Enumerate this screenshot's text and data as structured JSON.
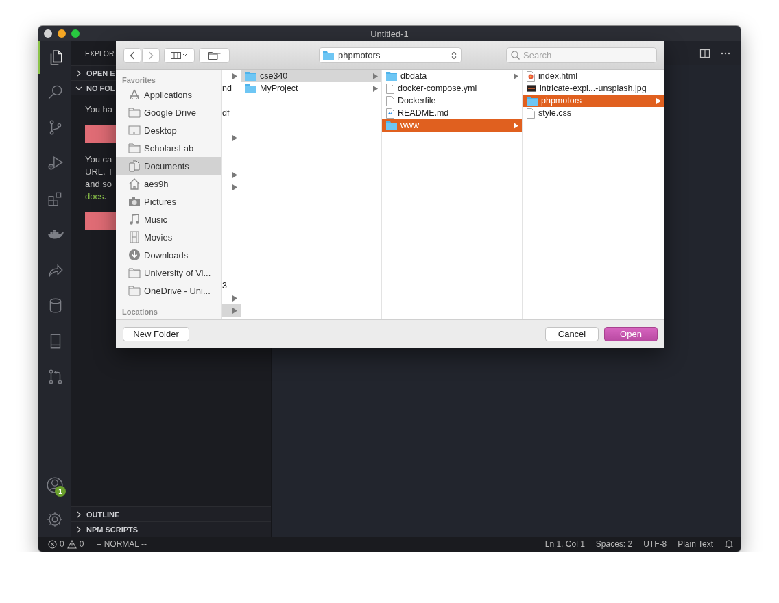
{
  "window": {
    "title": "Untitled-1"
  },
  "activity_bar": {
    "items": [
      {
        "selected": true
      },
      {
        "selected": false
      },
      {
        "selected": false
      },
      {
        "selected": false
      },
      {
        "selected": false
      },
      {
        "selected": false
      },
      {
        "selected": false
      },
      {
        "selected": false
      },
      {
        "selected": false
      },
      {
        "selected": false
      }
    ],
    "account_badge": "1"
  },
  "sidebar": {
    "title": "EXPLOR",
    "sections": [
      {
        "label": "OPEN E",
        "expanded": false
      },
      {
        "label": "NO FOL",
        "expanded": true
      }
    ],
    "content": [
      {
        "kind": "text",
        "text": "You ha"
      },
      {
        "kind": "button"
      },
      {
        "kind": "paragraph",
        "lines": [
          "You ca",
          "URL. T",
          "and so"
        ],
        "link": "docs",
        "after_link": "."
      },
      {
        "kind": "button"
      }
    ],
    "bottom_sections": [
      {
        "label": "OUTLINE",
        "expanded": false
      },
      {
        "label": "NPM SCRIPTS",
        "expanded": false
      }
    ]
  },
  "dialog": {
    "location": "phpmotors",
    "search": {
      "placeholder": "Search"
    },
    "sidebar": {
      "sections": [
        {
          "title": "Favorites",
          "items": [
            {
              "label": "Applications",
              "selected": false
            },
            {
              "label": "Google Drive",
              "selected": false
            },
            {
              "label": "Desktop",
              "selected": false
            },
            {
              "label": "ScholarsLab",
              "selected": false
            },
            {
              "label": "Documents",
              "selected": true
            },
            {
              "label": "aes9h",
              "selected": false
            },
            {
              "label": "Pictures",
              "selected": false
            },
            {
              "label": "Music",
              "selected": false
            },
            {
              "label": "Movies",
              "selected": false
            },
            {
              "label": "Downloads",
              "selected": false
            },
            {
              "label": "University of Vi...",
              "selected": false
            },
            {
              "label": "OneDrive - Uni...",
              "selected": false
            }
          ]
        },
        {
          "title": "Locations"
        }
      ]
    },
    "columns": [
      {
        "focused": false,
        "items": [
          {
            "kind": "cut",
            "has_children": true,
            "selected": false
          },
          {
            "kind": "cut",
            "label": "nd",
            "has_children": false,
            "selected": false
          },
          {
            "kind": "cut",
            "has_children": false,
            "selected": false
          },
          {
            "kind": "cut",
            "label": "df",
            "has_children": false,
            "selected": false
          },
          {
            "kind": "cut",
            "has_children": false,
            "selected": false
          },
          {
            "kind": "cut",
            "has_children": true,
            "selected": false
          },
          {
            "kind": "cut",
            "has_children": false,
            "selected": false
          },
          {
            "kind": "cut",
            "has_children": false,
            "selected": false
          },
          {
            "kind": "cut",
            "has_children": true,
            "selected": false
          },
          {
            "kind": "cut",
            "has_children": true,
            "selected": false
          },
          {
            "kind": "cut",
            "has_children": false,
            "selected": false
          },
          {
            "kind": "cut",
            "has_children": false,
            "selected": false
          },
          {
            "kind": "cut",
            "has_children": false,
            "selected": false
          },
          {
            "kind": "cut",
            "has_children": false,
            "selected": false
          },
          {
            "kind": "cut",
            "has_children": false,
            "selected": false
          },
          {
            "kind": "cut",
            "has_children": false,
            "selected": false
          },
          {
            "kind": "cut",
            "has_children": false,
            "selected": false
          },
          {
            "kind": "cut",
            "label": "3",
            "has_children": false,
            "selected": false
          },
          {
            "kind": "cut",
            "has_children": true,
            "selected": false
          },
          {
            "kind": "cut",
            "has_children": true,
            "selected": true
          }
        ]
      },
      {
        "focused": false,
        "items": [
          {
            "kind": "folder",
            "label": "cse340",
            "has_children": true,
            "selected": true
          },
          {
            "kind": "folder",
            "label": "MyProject",
            "has_children": true,
            "selected": false
          }
        ]
      },
      {
        "focused": true,
        "items": [
          {
            "kind": "folder",
            "label": "dbdata",
            "has_children": true,
            "selected": false
          },
          {
            "kind": "file",
            "label": "docker-compose.yml",
            "has_children": false,
            "selected": false
          },
          {
            "kind": "file",
            "label": "Dockerfile",
            "has_children": false,
            "selected": false
          },
          {
            "kind": "code",
            "label": "README.md",
            "has_children": false,
            "selected": false
          },
          {
            "kind": "folder",
            "label": "www",
            "has_children": true,
            "selected": true
          }
        ]
      },
      {
        "focused": true,
        "items": [
          {
            "kind": "html",
            "label": "index.html",
            "has_children": false,
            "selected": false
          },
          {
            "kind": "image",
            "label": "intricate-expl...-unsplash.jpg",
            "has_children": false,
            "selected": false
          },
          {
            "kind": "folder",
            "label": "phpmotors",
            "has_children": true,
            "selected": true
          },
          {
            "kind": "file",
            "label": "style.css",
            "has_children": false,
            "selected": false
          }
        ]
      }
    ],
    "buttons": [
      {
        "label": "New Folder",
        "kind": "secondary"
      },
      {
        "label": "Cancel",
        "kind": "secondary"
      },
      {
        "label": "Open",
        "kind": "default"
      }
    ]
  },
  "status_bar": {
    "errors": "0",
    "warnings": "0",
    "mode": "-- NORMAL --",
    "right": [
      "Ln 1, Col 1",
      "Spaces: 2",
      "UTF-8",
      "Plain Text"
    ]
  }
}
